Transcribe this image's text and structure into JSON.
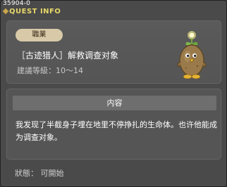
{
  "quest": {
    "id": "35904-0",
    "window_title": "QUEST INFO",
    "job_badge": "職業",
    "title": "［古迹猎人］解救调查对象",
    "level": "建議等級：10～14",
    "content_header": "内容",
    "content_text": "我发现了半截身子埋在地里不停挣扎的生命体。也许他能成为调查对象。",
    "status": "狀態： 可開始"
  },
  "icons": {
    "npc": "potato-npc-icon"
  },
  "colors": {
    "window_bg": "#4a4a4a",
    "panel_bg": "#555555",
    "header_bg": "#6e6e6e",
    "badge_bg": "#d8c9a8",
    "title_accent": "#e8d86a"
  }
}
